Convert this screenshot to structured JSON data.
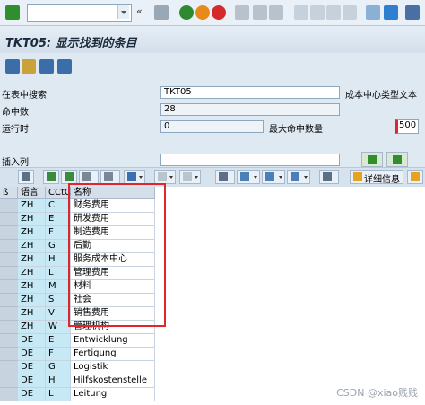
{
  "title": "TKT05: 显示找到的条目",
  "form": {
    "search_label": "在表中搜索",
    "search_value": "TKT05",
    "table_desc": "成本中心类型文本",
    "hits_label": "命中数",
    "hits_value": "28",
    "runtime_label": "运行时",
    "runtime_value": "0",
    "max_hits_label": "最大命中数量",
    "max_hits_value": "500",
    "insert_col_label": "插入列",
    "insert_col_value": ""
  },
  "alv": {
    "detail_label": "详细信息"
  },
  "grid": {
    "headers": {
      "sel": "ß",
      "lang": "语言",
      "type": "CCtC",
      "name": "名称"
    },
    "rows": [
      {
        "lang": "ZH",
        "type": "C",
        "name": "财务费用"
      },
      {
        "lang": "ZH",
        "type": "E",
        "name": "研发费用"
      },
      {
        "lang": "ZH",
        "type": "F",
        "name": "制造费用"
      },
      {
        "lang": "ZH",
        "type": "G",
        "name": "后勤"
      },
      {
        "lang": "ZH",
        "type": "H",
        "name": "服务成本中心"
      },
      {
        "lang": "ZH",
        "type": "L",
        "name": "管理费用"
      },
      {
        "lang": "ZH",
        "type": "M",
        "name": "材料"
      },
      {
        "lang": "ZH",
        "type": "S",
        "name": "社会"
      },
      {
        "lang": "ZH",
        "type": "V",
        "name": "销售费用"
      },
      {
        "lang": "ZH",
        "type": "W",
        "name": "管理机构"
      },
      {
        "lang": "DE",
        "type": "E",
        "name": "Entwicklung"
      },
      {
        "lang": "DE",
        "type": "F",
        "name": "Fertigung"
      },
      {
        "lang": "DE",
        "type": "G",
        "name": "Logistik"
      },
      {
        "lang": "DE",
        "type": "H",
        "name": "Hilfskostenstelle"
      },
      {
        "lang": "DE",
        "type": "L",
        "name": "Leitung"
      }
    ]
  },
  "watermark": "CSDN @xiao贱贱",
  "colors": {
    "accent_red": "#e0262b",
    "key_cell": "#c6e9f5"
  }
}
